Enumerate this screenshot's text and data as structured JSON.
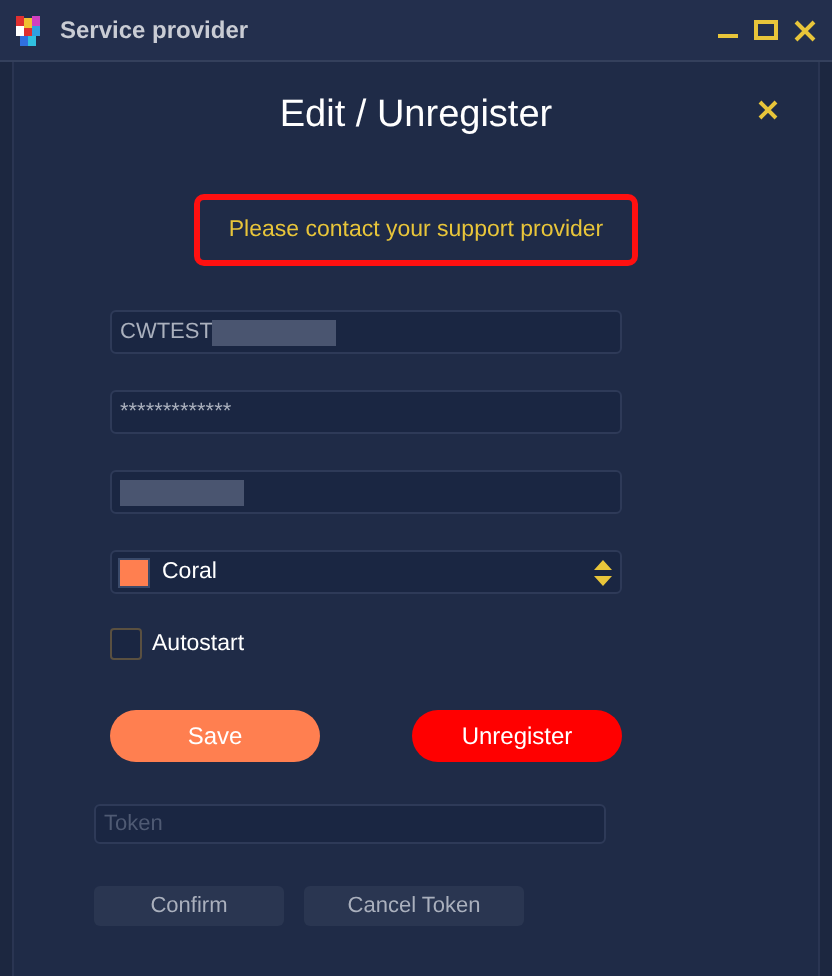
{
  "window": {
    "title": "Service provider"
  },
  "dialog": {
    "title": "Edit / Unregister"
  },
  "warning": "Please contact your support provider",
  "fields": [
    {
      "value": "CWTEST",
      "redacted": true
    },
    {
      "value": "*************",
      "redacted": false
    },
    {
      "redacted": true
    }
  ],
  "color_select": {
    "value": "Coral",
    "color": "#ff7f50"
  },
  "autostart": {
    "label": "Autostart",
    "checked": false
  },
  "buttons": [
    {
      "label": "Save",
      "kind": "save"
    },
    {
      "label": "Unregister",
      "kind": "danger"
    }
  ],
  "token": {
    "placeholder": "Token"
  },
  "token_buttons": [
    "Confirm",
    "Cancel Token"
  ]
}
